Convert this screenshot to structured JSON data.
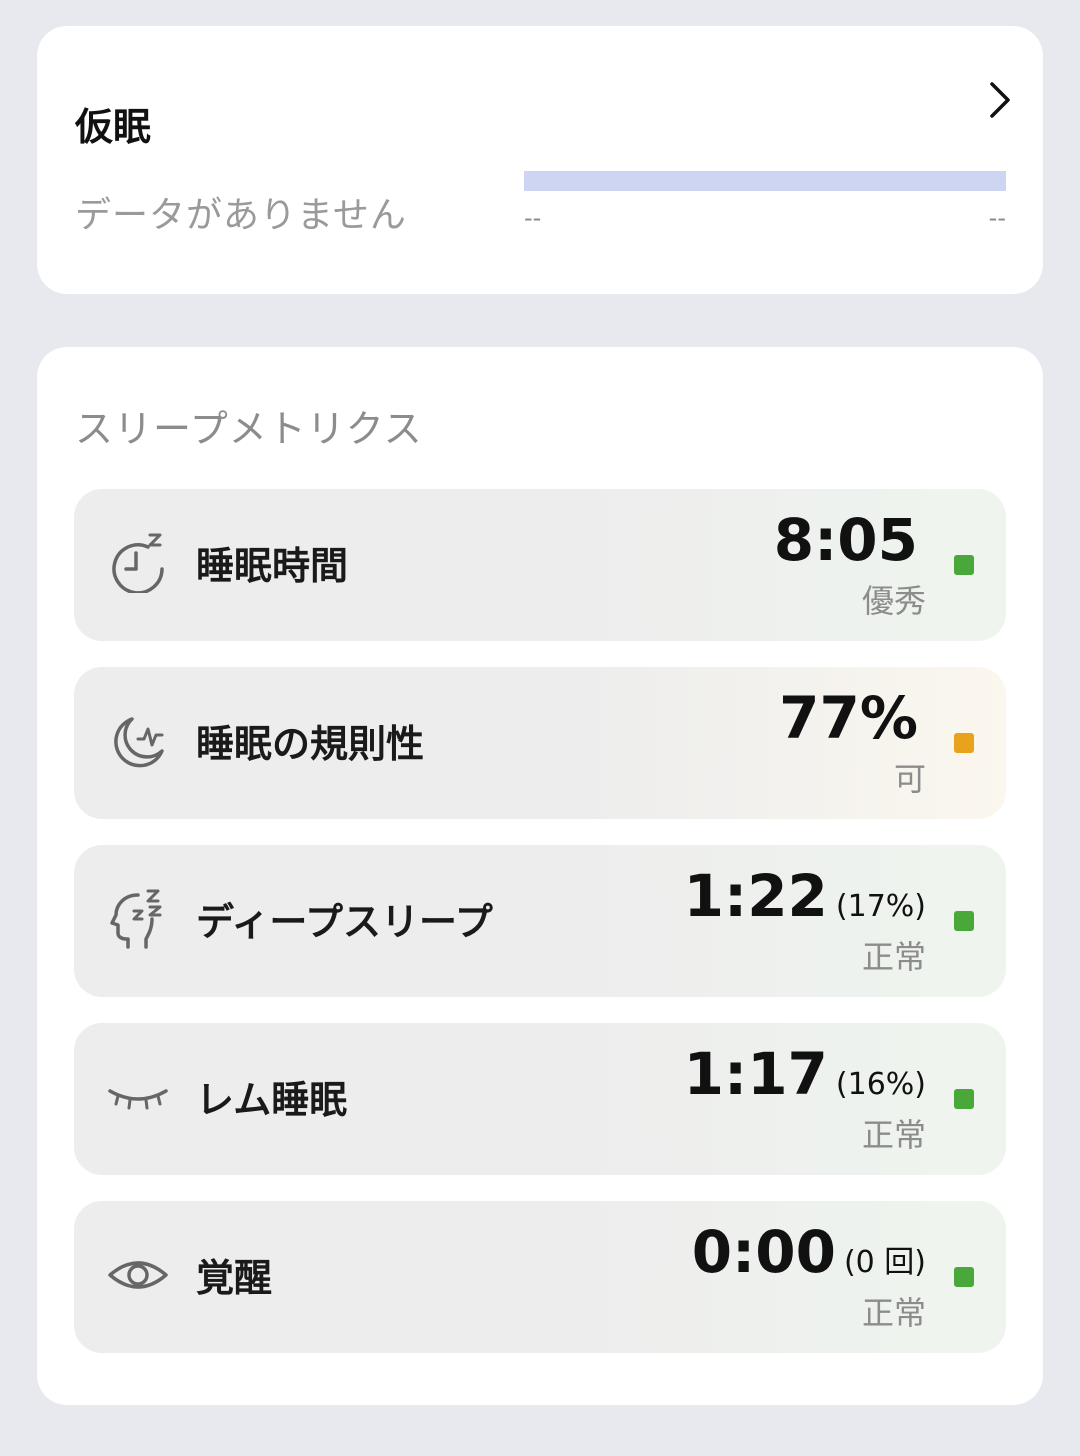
{
  "nap": {
    "title": "仮眠",
    "empty_text": "データがありません",
    "timeline_start": "--",
    "timeline_end": "--"
  },
  "metrics": {
    "title": "スリープメトリクス",
    "items": [
      {
        "icon": "clock-zzz-icon",
        "label": "睡眠時間",
        "value": "8:05",
        "extra": "",
        "status": "優秀",
        "status_color": "#4aa83a"
      },
      {
        "icon": "moon-wave-icon",
        "label": "睡眠の規則性",
        "value": "77%",
        "extra": "",
        "status": "可",
        "status_color": "#e8a21b"
      },
      {
        "icon": "head-zzz-icon",
        "label": "ディープスリープ",
        "value": "1:22",
        "extra": "(17%)",
        "status": "正常",
        "status_color": "#4aa83a"
      },
      {
        "icon": "closed-eye-icon",
        "label": "レム睡眠",
        "value": "1:17",
        "extra": "(16%)",
        "status": "正常",
        "status_color": "#4aa83a"
      },
      {
        "icon": "eye-icon",
        "label": "覚醒",
        "value": "0:00",
        "extra": "(0 回)",
        "status": "正常",
        "status_color": "#4aa83a"
      }
    ]
  }
}
